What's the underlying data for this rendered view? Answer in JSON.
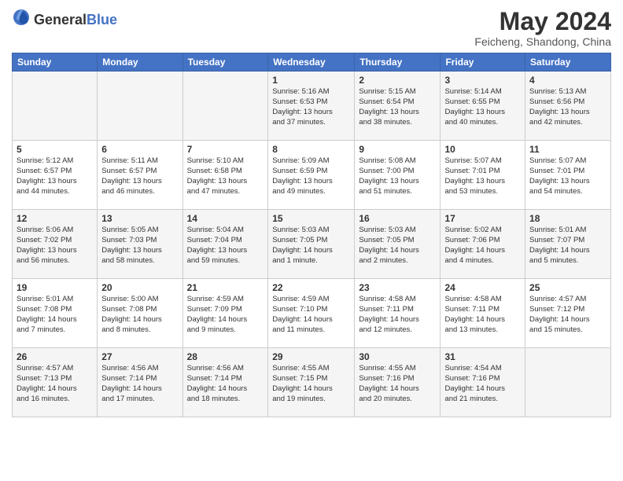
{
  "logo": {
    "general": "General",
    "blue": "Blue"
  },
  "title": "May 2024",
  "location": "Feicheng, Shandong, China",
  "days_of_week": [
    "Sunday",
    "Monday",
    "Tuesday",
    "Wednesday",
    "Thursday",
    "Friday",
    "Saturday"
  ],
  "weeks": [
    [
      {
        "day": "",
        "info": ""
      },
      {
        "day": "",
        "info": ""
      },
      {
        "day": "",
        "info": ""
      },
      {
        "day": "1",
        "info": "Sunrise: 5:16 AM\nSunset: 6:53 PM\nDaylight: 13 hours\nand 37 minutes."
      },
      {
        "day": "2",
        "info": "Sunrise: 5:15 AM\nSunset: 6:54 PM\nDaylight: 13 hours\nand 38 minutes."
      },
      {
        "day": "3",
        "info": "Sunrise: 5:14 AM\nSunset: 6:55 PM\nDaylight: 13 hours\nand 40 minutes."
      },
      {
        "day": "4",
        "info": "Sunrise: 5:13 AM\nSunset: 6:56 PM\nDaylight: 13 hours\nand 42 minutes."
      }
    ],
    [
      {
        "day": "5",
        "info": "Sunrise: 5:12 AM\nSunset: 6:57 PM\nDaylight: 13 hours\nand 44 minutes."
      },
      {
        "day": "6",
        "info": "Sunrise: 5:11 AM\nSunset: 6:57 PM\nDaylight: 13 hours\nand 46 minutes."
      },
      {
        "day": "7",
        "info": "Sunrise: 5:10 AM\nSunset: 6:58 PM\nDaylight: 13 hours\nand 47 minutes."
      },
      {
        "day": "8",
        "info": "Sunrise: 5:09 AM\nSunset: 6:59 PM\nDaylight: 13 hours\nand 49 minutes."
      },
      {
        "day": "9",
        "info": "Sunrise: 5:08 AM\nSunset: 7:00 PM\nDaylight: 13 hours\nand 51 minutes."
      },
      {
        "day": "10",
        "info": "Sunrise: 5:07 AM\nSunset: 7:01 PM\nDaylight: 13 hours\nand 53 minutes."
      },
      {
        "day": "11",
        "info": "Sunrise: 5:07 AM\nSunset: 7:01 PM\nDaylight: 13 hours\nand 54 minutes."
      }
    ],
    [
      {
        "day": "12",
        "info": "Sunrise: 5:06 AM\nSunset: 7:02 PM\nDaylight: 13 hours\nand 56 minutes."
      },
      {
        "day": "13",
        "info": "Sunrise: 5:05 AM\nSunset: 7:03 PM\nDaylight: 13 hours\nand 58 minutes."
      },
      {
        "day": "14",
        "info": "Sunrise: 5:04 AM\nSunset: 7:04 PM\nDaylight: 13 hours\nand 59 minutes."
      },
      {
        "day": "15",
        "info": "Sunrise: 5:03 AM\nSunset: 7:05 PM\nDaylight: 14 hours\nand 1 minute."
      },
      {
        "day": "16",
        "info": "Sunrise: 5:03 AM\nSunset: 7:05 PM\nDaylight: 14 hours\nand 2 minutes."
      },
      {
        "day": "17",
        "info": "Sunrise: 5:02 AM\nSunset: 7:06 PM\nDaylight: 14 hours\nand 4 minutes."
      },
      {
        "day": "18",
        "info": "Sunrise: 5:01 AM\nSunset: 7:07 PM\nDaylight: 14 hours\nand 5 minutes."
      }
    ],
    [
      {
        "day": "19",
        "info": "Sunrise: 5:01 AM\nSunset: 7:08 PM\nDaylight: 14 hours\nand 7 minutes."
      },
      {
        "day": "20",
        "info": "Sunrise: 5:00 AM\nSunset: 7:08 PM\nDaylight: 14 hours\nand 8 minutes."
      },
      {
        "day": "21",
        "info": "Sunrise: 4:59 AM\nSunset: 7:09 PM\nDaylight: 14 hours\nand 9 minutes."
      },
      {
        "day": "22",
        "info": "Sunrise: 4:59 AM\nSunset: 7:10 PM\nDaylight: 14 hours\nand 11 minutes."
      },
      {
        "day": "23",
        "info": "Sunrise: 4:58 AM\nSunset: 7:11 PM\nDaylight: 14 hours\nand 12 minutes."
      },
      {
        "day": "24",
        "info": "Sunrise: 4:58 AM\nSunset: 7:11 PM\nDaylight: 14 hours\nand 13 minutes."
      },
      {
        "day": "25",
        "info": "Sunrise: 4:57 AM\nSunset: 7:12 PM\nDaylight: 14 hours\nand 15 minutes."
      }
    ],
    [
      {
        "day": "26",
        "info": "Sunrise: 4:57 AM\nSunset: 7:13 PM\nDaylight: 14 hours\nand 16 minutes."
      },
      {
        "day": "27",
        "info": "Sunrise: 4:56 AM\nSunset: 7:14 PM\nDaylight: 14 hours\nand 17 minutes."
      },
      {
        "day": "28",
        "info": "Sunrise: 4:56 AM\nSunset: 7:14 PM\nDaylight: 14 hours\nand 18 minutes."
      },
      {
        "day": "29",
        "info": "Sunrise: 4:55 AM\nSunset: 7:15 PM\nDaylight: 14 hours\nand 19 minutes."
      },
      {
        "day": "30",
        "info": "Sunrise: 4:55 AM\nSunset: 7:16 PM\nDaylight: 14 hours\nand 20 minutes."
      },
      {
        "day": "31",
        "info": "Sunrise: 4:54 AM\nSunset: 7:16 PM\nDaylight: 14 hours\nand 21 minutes."
      },
      {
        "day": "",
        "info": ""
      }
    ]
  ]
}
